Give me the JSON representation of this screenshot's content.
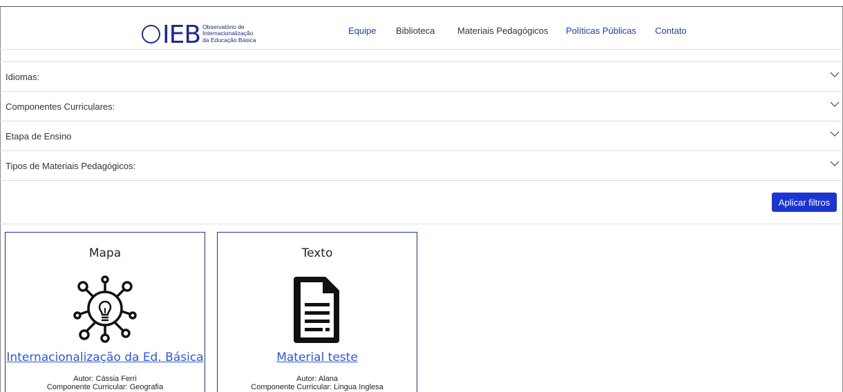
{
  "header": {
    "logo": {
      "mark": "IEB",
      "line1": "Observatório de",
      "line2": "Internacionalização",
      "line3": "da Educação Básica"
    },
    "nav": [
      {
        "label": "Equipe"
      },
      {
        "label": "Biblioteca"
      },
      {
        "label": "Materiais Pedagógicos"
      },
      {
        "label": "Políticas Públicas"
      },
      {
        "label": "Contato"
      }
    ]
  },
  "filters": [
    {
      "label": "Idiomas:"
    },
    {
      "label": "Componentes Curriculares:"
    },
    {
      "label": "Etapa de Ensino"
    },
    {
      "label": "Tipos de Materiais Pedagógicos:"
    }
  ],
  "apply_label": "Aplicar filtros",
  "cards": [
    {
      "type": "Mapa",
      "icon": "lightbulb-network-icon",
      "title": "Internacionalização da Ed. Básica",
      "author": "Autor: Cássia Ferri",
      "component": "Componente Curricular: Geografia"
    },
    {
      "type": "Texto",
      "icon": "document-icon",
      "title": "Material teste",
      "author": "Autor: Alana",
      "component": "Componente Curricular: Lingua Inglesa"
    }
  ],
  "colors": {
    "accent": "#1a35d1",
    "link": "#2b57e6",
    "brand": "#1d2a8c"
  }
}
